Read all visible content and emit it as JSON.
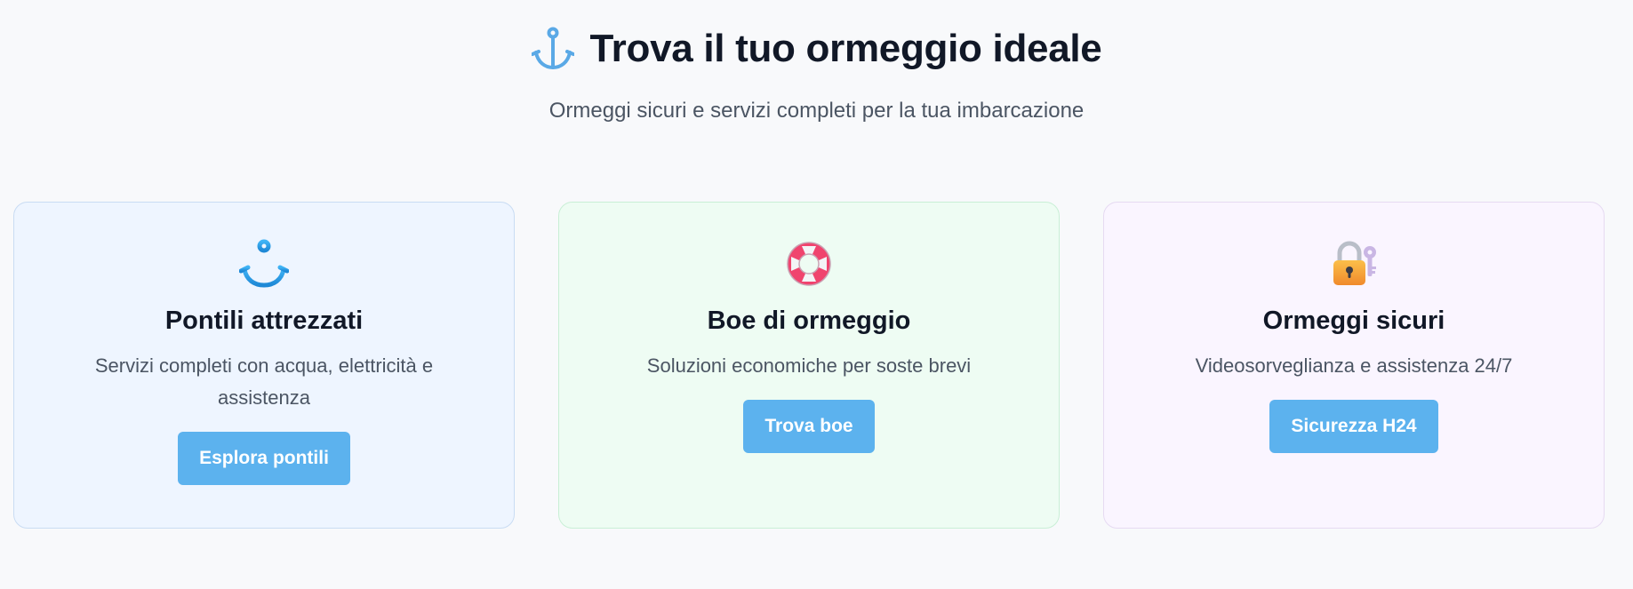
{
  "hero": {
    "title": "Trova il tuo ormeggio ideale",
    "title_icon": "anchor-icon",
    "subtitle": "Ormeggi sicuri e servizi completi per la tua imbarcazione"
  },
  "cards": [
    {
      "icon": "anchor-icon",
      "title": "Pontili attrezzati",
      "description": "Servizi completi con acqua, elettricità e assistenza",
      "button_label": "Esplora pontili",
      "theme": "blue"
    },
    {
      "icon": "lifebuoy-icon",
      "title": "Boe di ormeggio",
      "description": "Soluzioni economiche per soste brevi",
      "button_label": "Trova boe",
      "theme": "green"
    },
    {
      "icon": "lock-with-key-icon",
      "title": "Ormeggi sicuri",
      "description": "Videosorveglianza e assistenza 24/7",
      "button_label": "Sicurezza H24",
      "theme": "purple"
    }
  ],
  "colors": {
    "accent": "#5cb2ee",
    "title_text": "#111827",
    "body_text": "#4b5563",
    "page_background": "#f8f9fb"
  }
}
